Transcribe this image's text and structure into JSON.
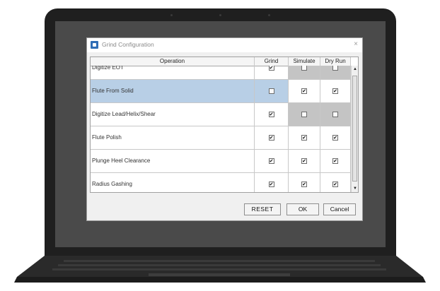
{
  "dialog": {
    "title": "Grind Configuration",
    "close_glyph": "×",
    "icon": "app-window-icon"
  },
  "table": {
    "headers": [
      "Operation",
      "Grind",
      "Simulate",
      "Dry Run"
    ],
    "rows": [
      {
        "operation": "Digitize EOT",
        "grind": true,
        "simulate": false,
        "dry_run": false,
        "simulate_disabled": true,
        "dry_run_disabled": true,
        "selected": false
      },
      {
        "operation": "Flute From Solid",
        "grind": false,
        "simulate": true,
        "dry_run": true,
        "simulate_disabled": false,
        "dry_run_disabled": false,
        "selected": true
      },
      {
        "operation": "Digitize Lead/Helix/Shear",
        "grind": true,
        "simulate": false,
        "dry_run": false,
        "simulate_disabled": true,
        "dry_run_disabled": true,
        "selected": false
      },
      {
        "operation": "Flute Polish",
        "grind": true,
        "simulate": true,
        "dry_run": true,
        "simulate_disabled": false,
        "dry_run_disabled": false,
        "selected": false
      },
      {
        "operation": "Plunge Heel Clearance",
        "grind": true,
        "simulate": true,
        "dry_run": true,
        "simulate_disabled": false,
        "dry_run_disabled": false,
        "selected": false
      },
      {
        "operation": "Radius Gashing",
        "grind": true,
        "simulate": true,
        "dry_run": true,
        "simulate_disabled": false,
        "dry_run_disabled": false,
        "selected": false
      }
    ]
  },
  "scrollbar": {
    "up_glyph": "▲",
    "down_glyph": "▼"
  },
  "buttons": {
    "reset": "RESET",
    "ok": "OK",
    "cancel": "Cancel"
  },
  "colors": {
    "selected_row": "#b8cfe6",
    "disabled_cell": "#c4c4c4",
    "app_icon": "#2f6db5"
  }
}
